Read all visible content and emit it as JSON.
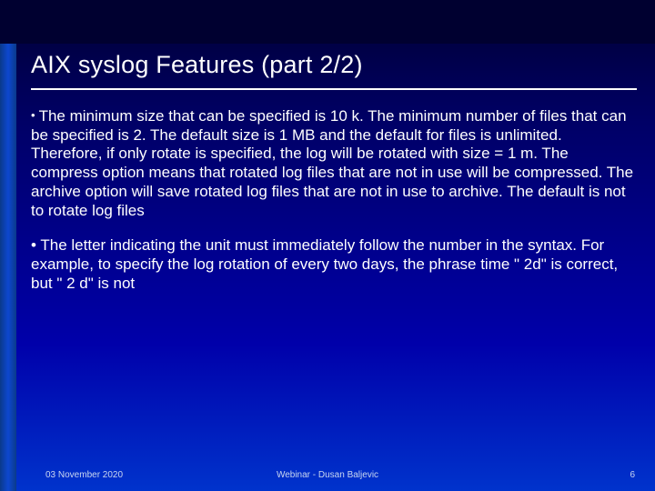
{
  "title": "AIX syslog Features (part 2/2)",
  "bullets": [
    "The minimum size that can be specified is 10 k. The minimum number of files that can be specified is 2. The default size is 1 MB and the default for files is unlimited. Therefore, if only rotate is specified, the log will be rotated with size = 1 m. The compress option means that rotated log files that are not in use will be compressed. The archive option will save rotated log files that are not in use to archive. The default is not to rotate log files",
    "The letter indicating the unit must immediately follow the number in the syntax. For example, to specify the log rotation of every two days, the phrase time \" 2d\" is correct, but \" 2 d\" is not"
  ],
  "footer": {
    "date": "03 November 2020",
    "center": "Webinar - Dusan Baljevic",
    "page": "6"
  }
}
